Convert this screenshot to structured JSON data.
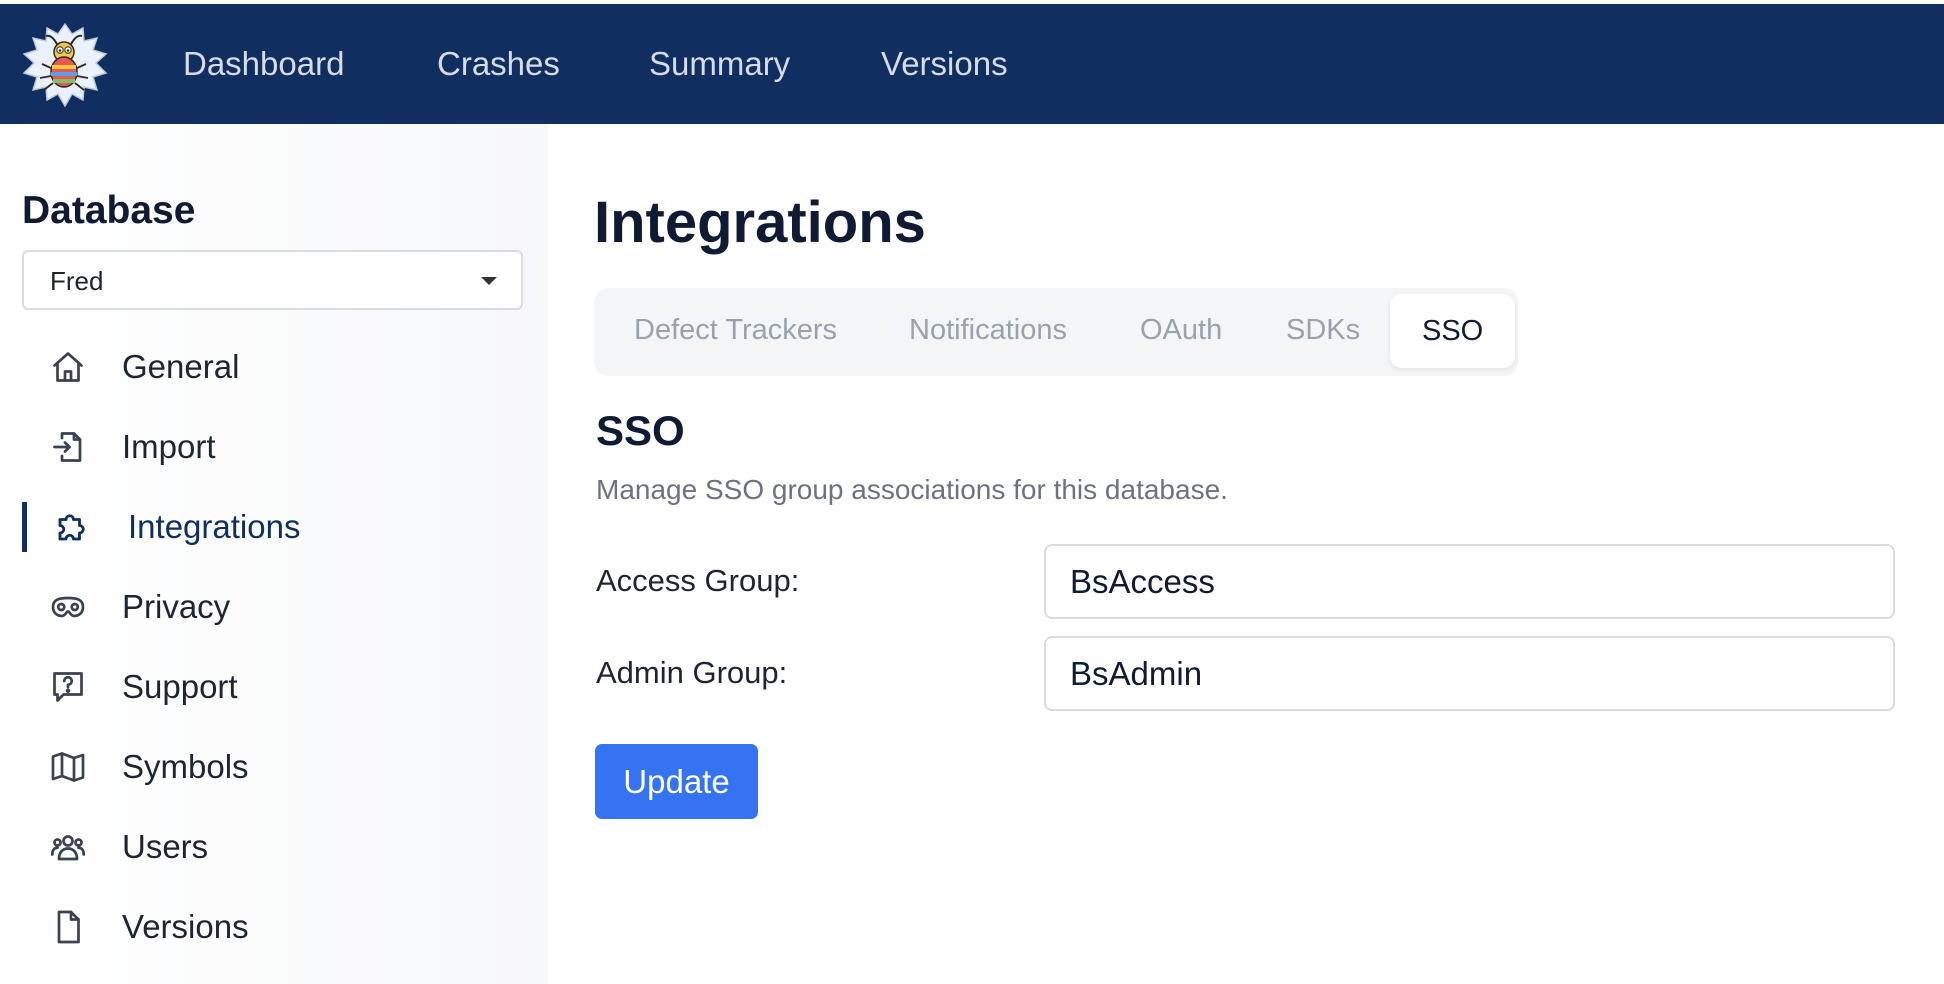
{
  "nav": {
    "logo_icon": "bug-mascot-logo",
    "items": [
      {
        "label": "Dashboard"
      },
      {
        "label": "Crashes"
      },
      {
        "label": "Summary"
      },
      {
        "label": "Versions"
      }
    ],
    "background": "#112e60"
  },
  "sidebar": {
    "title": "Database",
    "database_select": {
      "value": "Fred"
    },
    "items": [
      {
        "label": "General",
        "icon": "home-icon"
      },
      {
        "label": "Import",
        "icon": "import-icon"
      },
      {
        "label": "Integrations",
        "icon": "puzzle-icon",
        "active": true
      },
      {
        "label": "Privacy",
        "icon": "mask-icon"
      },
      {
        "label": "Support",
        "icon": "help-chat-icon"
      },
      {
        "label": "Symbols",
        "icon": "map-icon"
      },
      {
        "label": "Users",
        "icon": "users-icon"
      },
      {
        "label": "Versions",
        "icon": "file-icon"
      }
    ]
  },
  "main": {
    "title": "Integrations",
    "tabs": [
      {
        "label": "Defect Trackers"
      },
      {
        "label": "Notifications"
      },
      {
        "label": "OAuth"
      },
      {
        "label": "SDKs"
      },
      {
        "label": "SSO",
        "active": true
      }
    ],
    "section": {
      "title": "SSO",
      "description": "Manage SSO group associations for this database."
    },
    "form": {
      "access_group": {
        "label": "Access Group:",
        "value": "BsAccess"
      },
      "admin_group": {
        "label": "Admin Group:",
        "value": "BsAdmin"
      },
      "submit_label": "Update"
    },
    "accent_color": "#3573f2"
  }
}
